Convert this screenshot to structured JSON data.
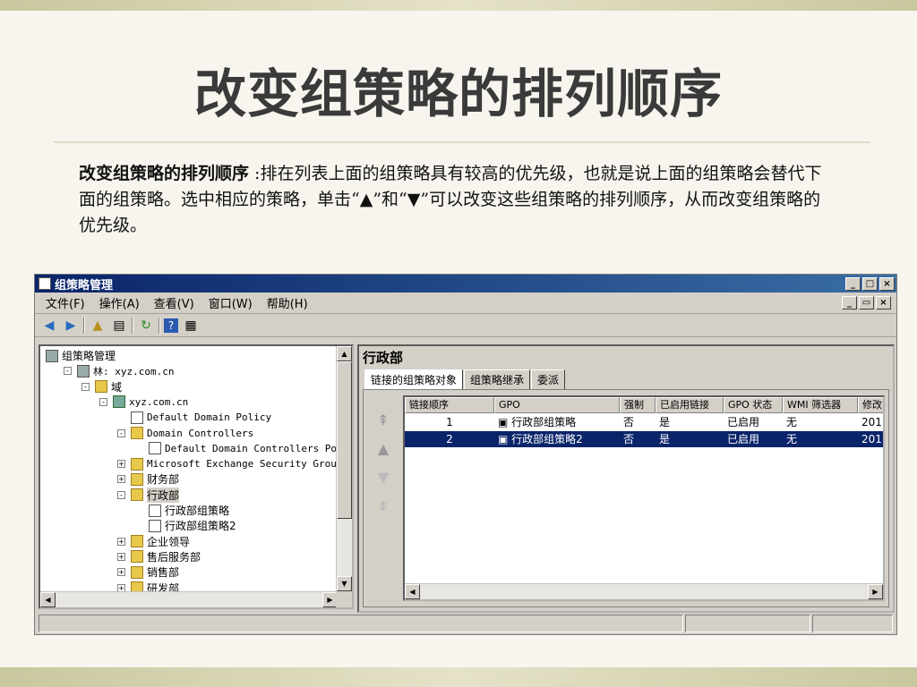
{
  "slide": {
    "title": "改变组策略的排列顺序",
    "desc_bold": "改变组策略的排列顺序",
    "desc_text": " :排在列表上面的组策略具有较高的优先级，也就是说上面的组策略会替代下面的组策略。选中相应的策略，单击“▲”和“▼”可以改变这些组策略的排列顺序，从而改变组策略的优先级。"
  },
  "window": {
    "title": "组策略管理",
    "buttons": [
      "_",
      "□",
      "×"
    ],
    "doc_buttons": [
      "_",
      "▭",
      "×"
    ]
  },
  "menu": [
    "文件(F)",
    "操作(A)",
    "查看(V)",
    "窗口(W)",
    "帮助(H)"
  ],
  "tree": [
    {
      "label": "组策略管理",
      "indent": 0,
      "icon": "root",
      "pm": ""
    },
    {
      "label": "林: xyz.com.cn",
      "indent": 1,
      "icon": "forest",
      "pm": "−",
      "mono": true
    },
    {
      "label": "域",
      "indent": 2,
      "icon": "folder",
      "pm": "−"
    },
    {
      "label": "xyz.com.cn",
      "indent": 3,
      "icon": "domain",
      "pm": "−",
      "mono": true
    },
    {
      "label": "Default Domain Policy",
      "indent": 4,
      "icon": "gpo",
      "pm": "",
      "mono": true
    },
    {
      "label": "Domain Controllers",
      "indent": 4,
      "icon": "folder",
      "pm": "−",
      "mono": true
    },
    {
      "label": "Default Domain Controllers Poli",
      "indent": 5,
      "icon": "gpo",
      "pm": "",
      "mono": true
    },
    {
      "label": "Microsoft Exchange Security Groups",
      "indent": 4,
      "icon": "folder",
      "pm": "+",
      "mono": true
    },
    {
      "label": "财务部",
      "indent": 4,
      "icon": "folder",
      "pm": "+"
    },
    {
      "label": "行政部",
      "indent": 4,
      "icon": "folder",
      "pm": "−"
    },
    {
      "label": "行政部组策略",
      "indent": 5,
      "icon": "gpo",
      "pm": ""
    },
    {
      "label": "行政部组策略2",
      "indent": 5,
      "icon": "gpo",
      "pm": ""
    },
    {
      "label": "企业领导",
      "indent": 4,
      "icon": "folder",
      "pm": "+"
    },
    {
      "label": "售后服务部",
      "indent": 4,
      "icon": "folder",
      "pm": "+"
    },
    {
      "label": "销售部",
      "indent": 4,
      "icon": "folder",
      "pm": "+"
    },
    {
      "label": "研发部",
      "indent": 4,
      "icon": "folder",
      "pm": "+"
    }
  ],
  "right": {
    "ou_title": "行政部",
    "tabs": [
      "链接的组策略对象",
      "组策略继承",
      "委派"
    ],
    "arrows": [
      "⇞",
      "▲",
      "▼",
      "⇟"
    ],
    "columns": [
      "链接顺序",
      "GPO",
      "强制",
      "已启用链接",
      "GPO 状态",
      "WMI 筛选器",
      "修改"
    ],
    "rows": [
      [
        "1",
        "行政部组策略",
        "否",
        "是",
        "已启用",
        "无",
        "201"
      ],
      [
        "2",
        "行政部组策略2",
        "否",
        "是",
        "已启用",
        "无",
        "201"
      ]
    ],
    "selected_row": 1
  }
}
